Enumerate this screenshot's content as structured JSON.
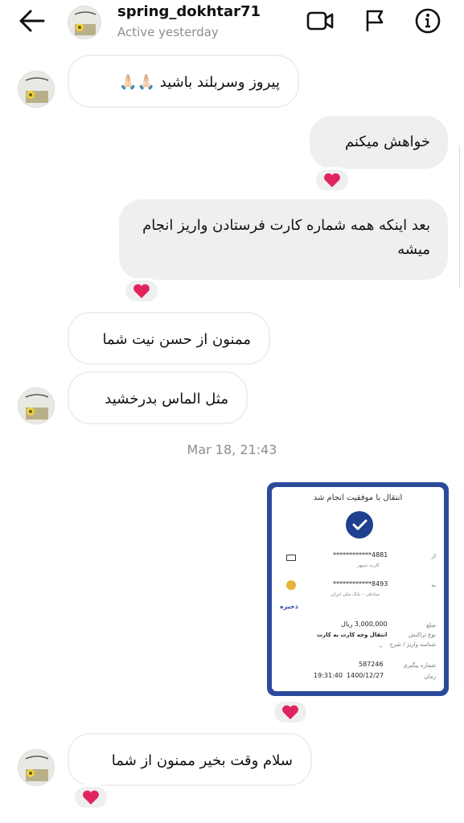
{
  "header": {
    "username": "spring_dokhtar71",
    "status": "Active yesterday",
    "back_icon": "arrow-left-icon",
    "video_icon": "video-camera-icon",
    "report_icon": "flag-icon",
    "info_icon": "info-icon"
  },
  "messages": {
    "m1": "پیروز وسربلند باشید 🙏🏻🙏🏻",
    "m2": "خواهش میکنم",
    "m3": "بعد اینکه همه شماره کارت فرستادن واریز انجام میشه",
    "m4": "ممنون از حسن نیت شما",
    "m5": "مثل الماس بدرخشید",
    "m6": "سلام وقت بخیر ممنون از شما"
  },
  "timestamp": "Mar 18, 21:43",
  "receipt": {
    "title": "انتقال با موفقیت انجام شد",
    "from_label": "از",
    "from_card": "************4881",
    "from_bank": "کارت سپهر",
    "to_label": "به",
    "to_card": "************8493",
    "to_bank": "صادقی - بانک ملی ایران",
    "save": "ذخیره",
    "amount_label": "مبلغ",
    "amount": "3,000,000 ریال",
    "type_label": "نوع تراکنش",
    "type": "انتقال وجه کارت به کارت",
    "id_label": "شناسه واریز / شرح",
    "id": "-",
    "tracking_label": "شماره پیگیری",
    "tracking": "587246",
    "time_label": "زمان",
    "time": "19:31:40  1400/12/27"
  },
  "colors": {
    "outgoing_bubble": "#efefef",
    "heart": "#e0245e",
    "receipt_border": "#2b4a9b"
  }
}
